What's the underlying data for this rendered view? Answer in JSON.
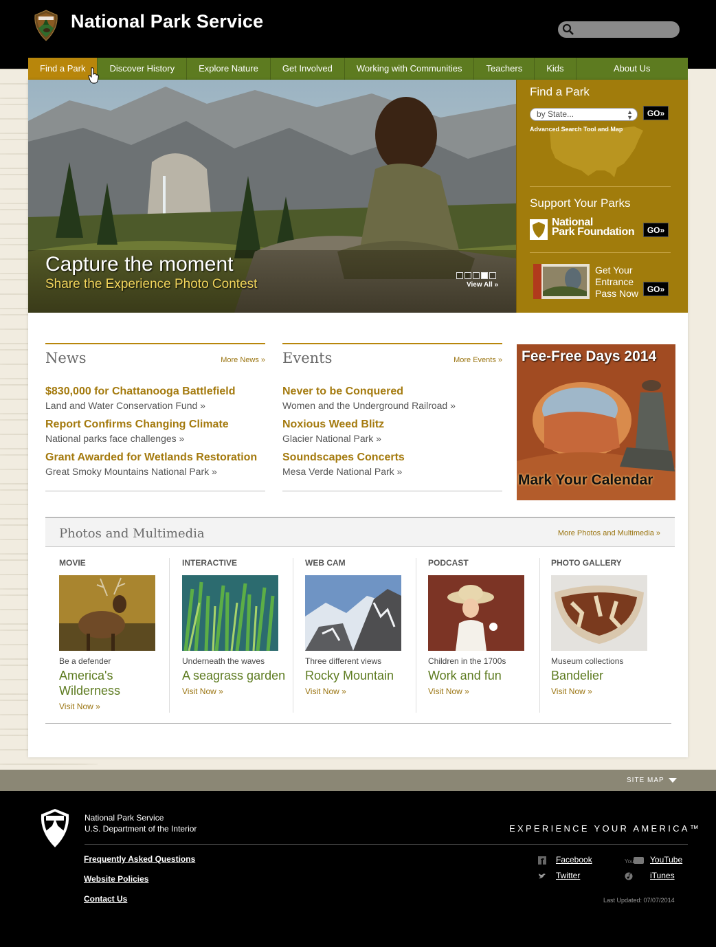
{
  "header": {
    "site_title": "National Park Service",
    "search_placeholder": ""
  },
  "nav": [
    {
      "label": "Find a Park",
      "active": true
    },
    {
      "label": "Discover History"
    },
    {
      "label": "Explore Nature"
    },
    {
      "label": "Get Involved"
    },
    {
      "label": "Working with Communities"
    },
    {
      "label": "Teachers"
    },
    {
      "label": "Kids"
    },
    {
      "label": "About Us"
    }
  ],
  "hero": {
    "title": "Capture the moment",
    "subtitle": "Share the Experience Photo Contest",
    "slides_total": 5,
    "slide_active": 4,
    "view_all": "View All »"
  },
  "side": {
    "find_title": "Find a Park",
    "select_value": "by State...",
    "go": "GO»",
    "advanced": "Advanced Search Tool and Map",
    "support_title": "Support Your Parks",
    "npf_line1": "National",
    "npf_line2": "Park Foundation",
    "pass_text": "Get Your Entrance Pass Now"
  },
  "news": {
    "title": "News",
    "more": "More News »",
    "items": [
      {
        "title": "$830,000 for Chattanooga Battlefield",
        "sub": "Land and Water Conservation Fund »"
      },
      {
        "title": "Report Confirms Changing Climate",
        "sub": "National parks face challenges »"
      },
      {
        "title": "Grant Awarded for Wetlands Restoration",
        "sub": "Great Smoky Mountains National Park »"
      }
    ]
  },
  "events": {
    "title": "Events",
    "more": "More Events »",
    "items": [
      {
        "title": "Never to be Conquered",
        "sub": "Women and the Underground Railroad »"
      },
      {
        "title": "Noxious Weed Blitz",
        "sub": "Glacier National Park »"
      },
      {
        "title": "Soundscapes Concerts",
        "sub": "Mesa Verde National Park »"
      }
    ]
  },
  "fee": {
    "title": "Fee-Free Days 2014",
    "cta": "Mark Your Calendar"
  },
  "multimedia": {
    "title": "Photos and Multimedia",
    "more": "More Photos and Multimedia »",
    "items": [
      {
        "type": "MOVIE",
        "caption": "Be a defender",
        "title": "America's Wilderness",
        "visit": "Visit Now »"
      },
      {
        "type": "INTERACTIVE",
        "caption": "Underneath the waves",
        "title": "A seagrass garden",
        "visit": "Visit Now »"
      },
      {
        "type": "WEB CAM",
        "caption": "Three different views",
        "title": "Rocky Mountain",
        "visit": "Visit Now »"
      },
      {
        "type": "PODCAST",
        "caption": "Children in the 1700s",
        "title": "Work and fun",
        "visit": "Visit Now »"
      },
      {
        "type": "PHOTO GALLERY",
        "caption": "Museum collections",
        "title": "Bandelier",
        "visit": "Visit Now »"
      }
    ]
  },
  "footer": {
    "sitemap": "SITE MAP",
    "org_line1": "National Park Service",
    "org_line2": "U.S. Department of the Interior",
    "tagline": "EXPERIENCE YOUR AMERICA™",
    "links": [
      "Frequently Asked Questions",
      "Website Policies",
      "Contact Us"
    ],
    "social": {
      "facebook": "Facebook",
      "twitter": "Twitter",
      "youtube": "YouTube",
      "itunes": "iTunes"
    },
    "updated": "Last Updated: 07/07/2014"
  },
  "colors": {
    "nav_green": "#5d7b20",
    "gold": "#b8860b",
    "panel_gold": "#a17c0c",
    "link_gold": "#a47a0e"
  }
}
